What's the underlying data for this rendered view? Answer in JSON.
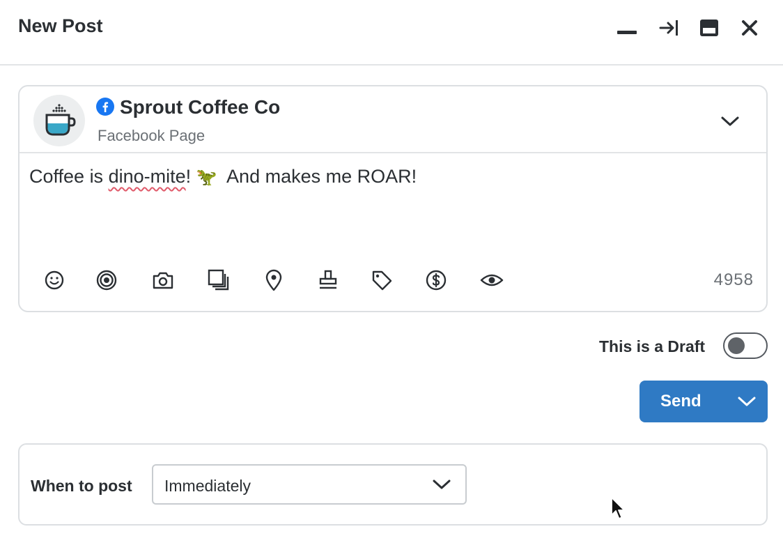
{
  "window": {
    "title": "New Post",
    "controls": [
      "minimize-icon",
      "dock-right-icon",
      "window-icon",
      "close-icon"
    ]
  },
  "profile": {
    "network_icon": "facebook-icon",
    "name": "Sprout Coffee Co",
    "type": "Facebook Page"
  },
  "post": {
    "text_before": "Coffee is ",
    "text_misspelled": "dino-mite",
    "text_mid": "! ",
    "emoji": "🦖",
    "text_after": "  And makes me ROAR!",
    "char_count": "4958"
  },
  "toolbar": {
    "tools": [
      "emoji-icon",
      "target-icon",
      "camera-icon",
      "gallery-icon",
      "location-icon",
      "stamp-icon",
      "tag-icon",
      "dollar-icon",
      "eye-icon"
    ]
  },
  "draft": {
    "label": "This is a Draft",
    "enabled": false
  },
  "send": {
    "label": "Send"
  },
  "schedule": {
    "label": "When to post",
    "selected": "Immediately"
  },
  "colors": {
    "accent": "#2f7ac4",
    "facebook": "#1877f2",
    "cup_fill": "#3aa8c8"
  }
}
